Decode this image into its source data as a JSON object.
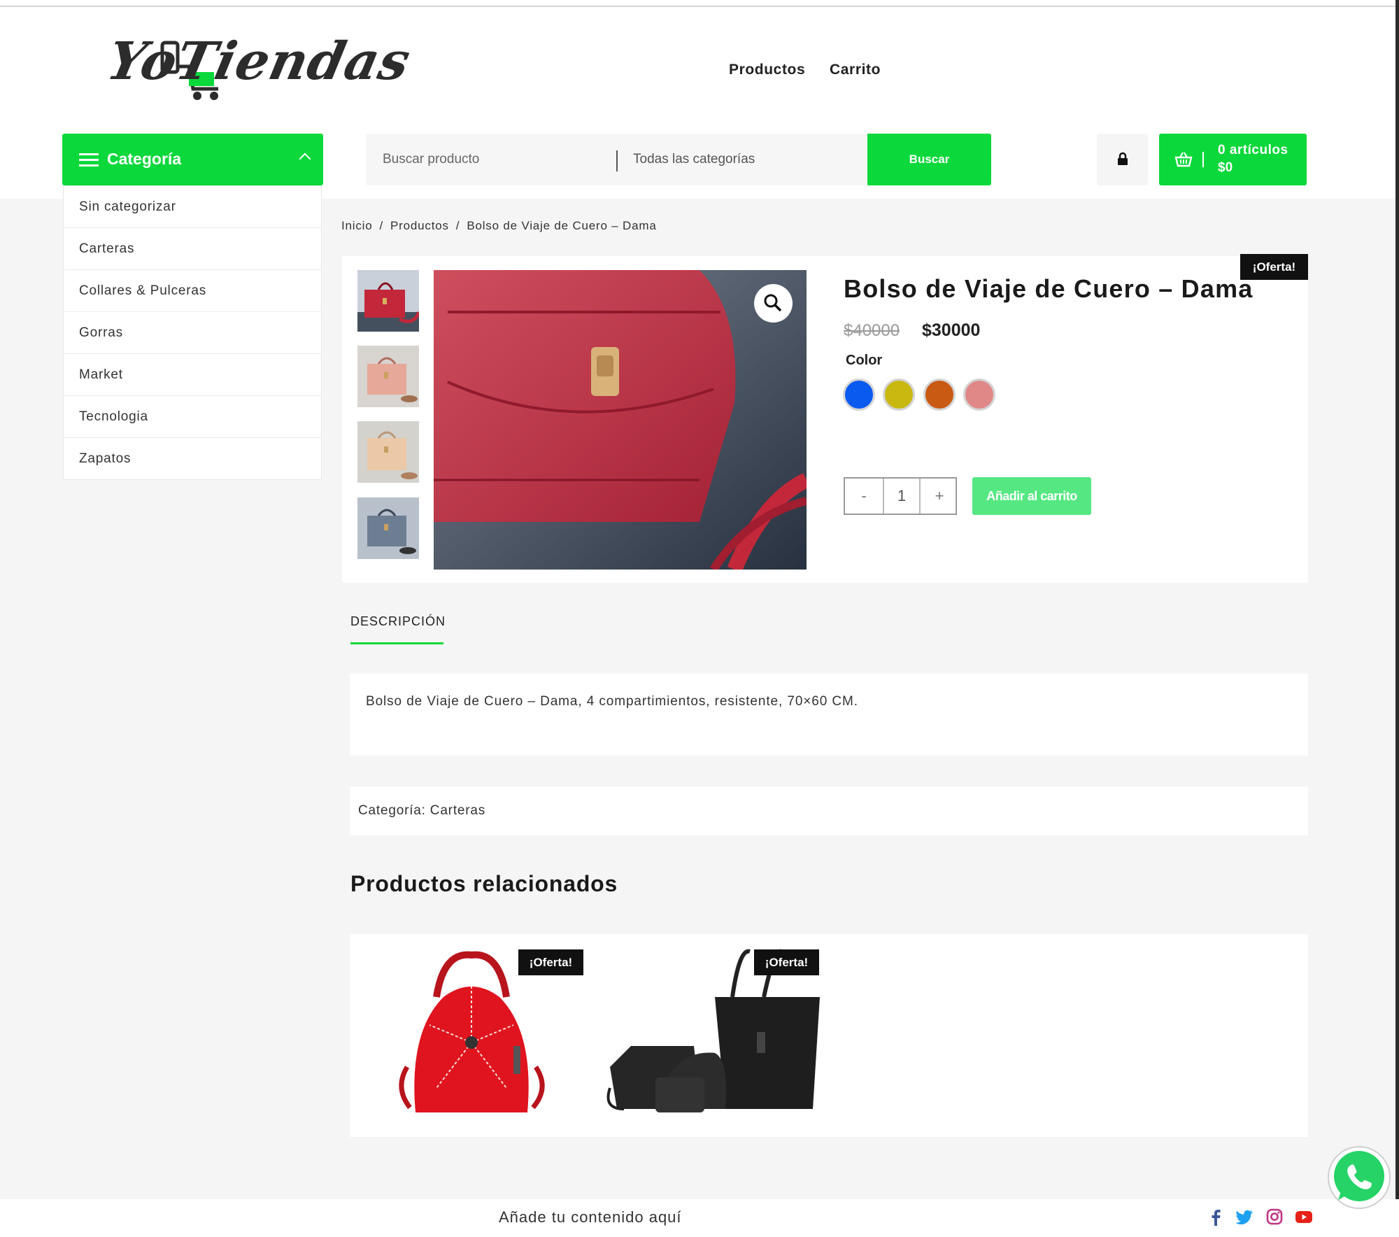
{
  "header": {
    "logo_text": "YoTiendas",
    "nav": [
      "Productos",
      "Carrito"
    ]
  },
  "category_menu": {
    "title": "Categoría",
    "items": [
      "Sin categorizar",
      "Carteras",
      "Collares & Pulceras",
      "Gorras",
      "Market",
      "Tecnologia",
      "Zapatos"
    ]
  },
  "search": {
    "placeholder": "Buscar producto",
    "category_select": "Todas las categorías",
    "button": "Buscar"
  },
  "cart": {
    "count_label": "0 artículos",
    "amount": "$0"
  },
  "breadcrumb": [
    "Inicio",
    "/",
    "Productos",
    "/",
    "Bolso de Viaje de Cuero – Dama"
  ],
  "product": {
    "badge": "¡Oferta!",
    "title": "Bolso de Viaje de Cuero – Dama",
    "old_price": "$40000",
    "new_price": "$30000",
    "color_label": "Color",
    "colors": [
      "#0a5af0",
      "#c8b810",
      "#c85a14",
      "#e08888"
    ],
    "quantity": "1",
    "minus": "-",
    "plus": "+",
    "add_to_cart": "Añadir al carrito"
  },
  "tabs": {
    "description_tab": "DESCRIPCIÓN",
    "description_text": "Bolso de Viaje de Cuero – Dama, 4 compartimientos, resistente, 70×60 CM."
  },
  "meta": {
    "category_line": "Categoría: Carteras"
  },
  "related": {
    "title": "Productos relacionados",
    "items": [
      {
        "badge": "¡Oferta!",
        "image": "red-backpack"
      },
      {
        "badge": "¡Oferta!",
        "image": "black-bag-set"
      }
    ]
  },
  "footer": {
    "text": "Añade tu contenido aquí",
    "social": [
      "facebook-icon",
      "twitter-icon",
      "instagram-icon",
      "youtube-icon"
    ]
  },
  "colors": {
    "accent": "#0bd83a",
    "badge": "#111111"
  }
}
